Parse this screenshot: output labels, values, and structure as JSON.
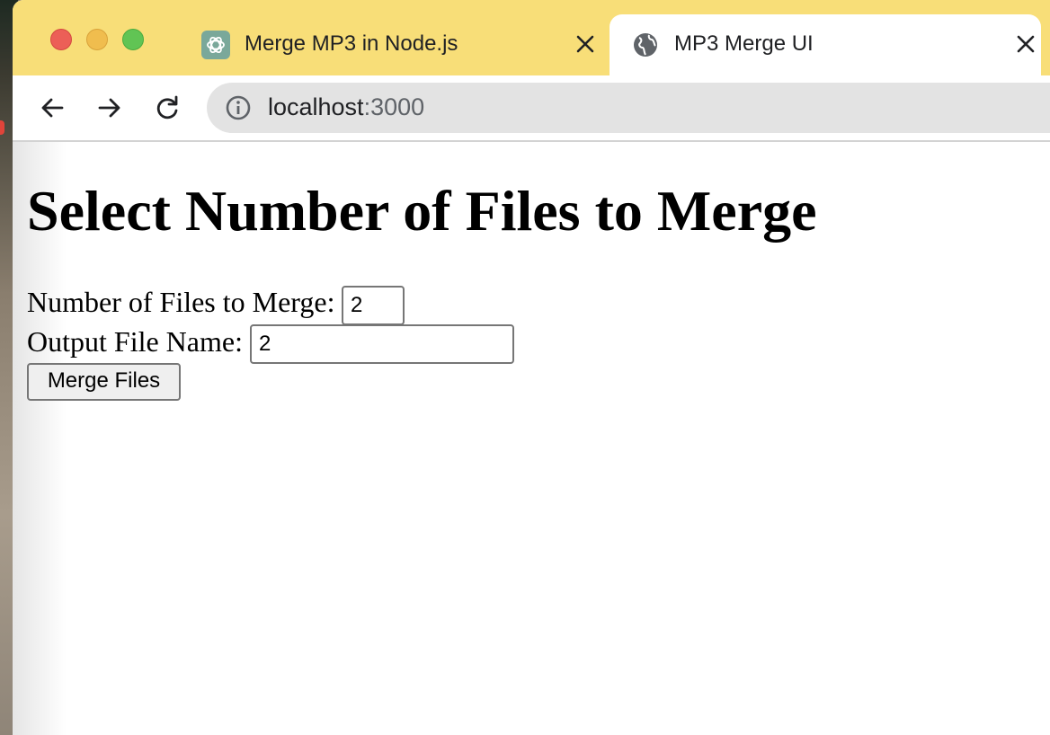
{
  "browser": {
    "tabs": [
      {
        "title": "Merge MP3 in Node.js",
        "icon": "chatgpt-icon",
        "active": false
      },
      {
        "title": "MP3 Merge UI",
        "icon": "globe-icon",
        "active": true
      }
    ],
    "address": {
      "host": "localhost",
      "port": ":3000"
    }
  },
  "page": {
    "title": "Select Number of Files to Merge",
    "num_files_label": "Number of Files to Merge:",
    "num_files_value": "2",
    "output_name_label": "Output File Name:",
    "output_name_value": "2",
    "merge_button_label": "Merge Files"
  },
  "colors": {
    "titlebar": "#f8de78",
    "close": "#ec5f57",
    "minimize": "#f0bd4e",
    "maximize": "#61c454",
    "omnibox": "#e3e3e3"
  }
}
